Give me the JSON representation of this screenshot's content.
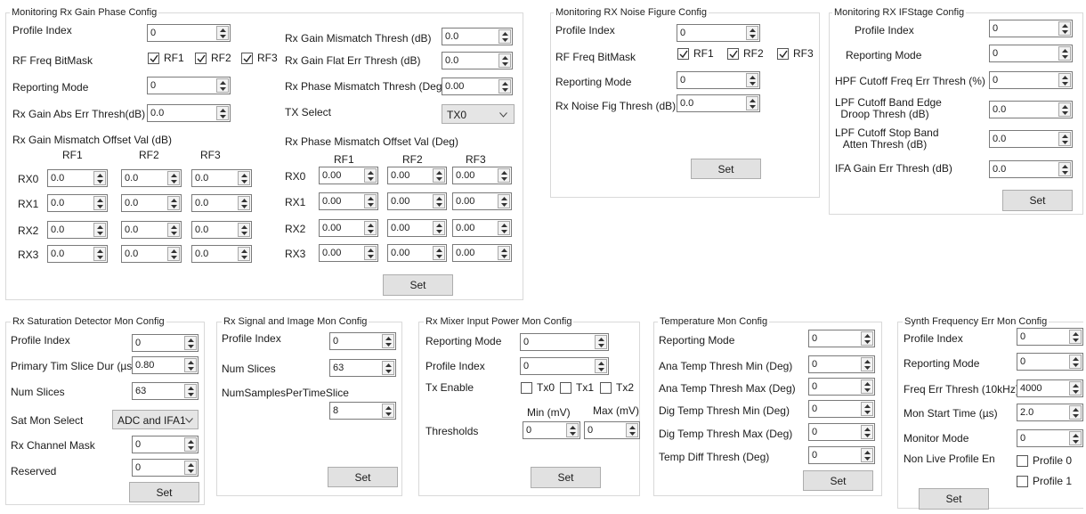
{
  "rx_gain_phase": {
    "title": "Monitoring Rx Gain Phase Config",
    "profile_index_label": "Profile Index",
    "profile_index": "0",
    "rf_freq_label": "RF Freq BitMask",
    "rf1": "RF1",
    "rf2": "RF2",
    "rf3": "RF3",
    "reporting_mode_label": "Reporting Mode",
    "reporting_mode": "0",
    "gain_abs_err_label": "Rx Gain Abs Err Thresh(dB)",
    "gain_abs_err": "0.0",
    "gain_mismatch_thresh_label": "Rx Gain Mismatch Thresh (dB)",
    "gain_mismatch_thresh": "0.0",
    "gain_flat_err_label": "Rx Gain Flat Err Thresh (dB)",
    "gain_flat_err": "0.0",
    "phase_mismatch_thresh_label": "Rx Phase Mismatch Thresh (Deg)",
    "phase_mismatch_thresh": "0.00",
    "tx_select_label": "TX Select",
    "tx_select": "TX0",
    "gain_offset_label": "Rx Gain Mismatch Offset Val (dB)",
    "phase_offset_label": "Rx Phase Mismatch Offset Val (Deg)",
    "cols": [
      "RF1",
      "RF2",
      "RF3"
    ],
    "rows": [
      "RX0",
      "RX1",
      "RX2",
      "RX3"
    ],
    "gain_value": "0.0",
    "phase_value": "0.00",
    "set": "Set"
  },
  "noise_figure": {
    "title": "Monitoring RX Noise Figure Config",
    "profile_index_label": "Profile Index",
    "profile_index": "0",
    "rf_freq_label": "RF Freq BitMask",
    "rf1": "RF1",
    "rf2": "RF2",
    "rf3": "RF3",
    "reporting_mode_label": "Reporting Mode",
    "reporting_mode": "0",
    "noise_fig_thresh_label": "Rx Noise Fig Thresh (dB)",
    "noise_fig_thresh": "0.0",
    "set": "Set"
  },
  "ifstage": {
    "title": "Monitoring RX IFStage Config",
    "profile_index_label": "Profile Index",
    "profile_index": "0",
    "reporting_mode_label": "Reporting Mode",
    "reporting_mode": "0",
    "hpf_label": "HPF Cutoff Freq Err Thresh (%)",
    "hpf": "0",
    "lpf_droop_label1": "LPF Cutoff Band Edge",
    "lpf_droop_label2": "Droop Thresh (dB)",
    "lpf_droop": "0.0",
    "lpf_atten_label1": "LPF Cutoff Stop Band",
    "lpf_atten_label2": "Atten Thresh (dB)",
    "lpf_atten": "0.0",
    "ifa_gain_label": "IFA Gain Err Thresh (dB)",
    "ifa_gain": "0.0",
    "set": "Set"
  },
  "saturation": {
    "title": "Rx Saturation Detector Mon Config",
    "profile_index_label": "Profile Index",
    "profile_index": "0",
    "primary_slice_label": "Primary Tim Slice Dur (µs)",
    "primary_slice": "0.80",
    "num_slices_label": "Num Slices",
    "num_slices": "63",
    "sat_mon_select_label": "Sat Mon Select",
    "sat_mon_select": "ADC and IFA1",
    "channel_mask_label": "Rx Channel Mask",
    "channel_mask": "0",
    "reserved_label": "Reserved",
    "reserved": "0",
    "set": "Set"
  },
  "signal_image": {
    "title": "Rx Signal and Image Mon Config",
    "profile_index_label": "Profile Index",
    "profile_index": "0",
    "num_slices_label": "Num Slices",
    "num_slices": "63",
    "samples_label": "NumSamplesPerTimeSlice",
    "samples": "8",
    "set": "Set"
  },
  "mixer": {
    "title": "Rx Mixer Input Power Mon Config",
    "reporting_mode_label": "Reporting Mode",
    "reporting_mode": "0",
    "profile_index_label": "Profile Index",
    "profile_index": "0",
    "tx_enable_label": "Tx Enable",
    "tx0": "Tx0",
    "tx1": "Tx1",
    "tx2": "Tx2",
    "min_label": "Min (mV)",
    "max_label": "Max (mV)",
    "thresholds_label": "Thresholds",
    "min": "0",
    "max": "0",
    "set": "Set"
  },
  "temperature": {
    "title": "Temperature Mon Config",
    "reporting_mode_label": "Reporting Mode",
    "reporting_mode": "0",
    "ana_min_label": "Ana Temp Thresh Min (Deg)",
    "ana_min": "0",
    "ana_max_label": "Ana Temp Thresh Max (Deg)",
    "ana_max": "0",
    "dig_min_label": "Dig Temp Thresh Min (Deg)",
    "dig_min": "0",
    "dig_max_label": "Dig Temp Thresh Max (Deg)",
    "dig_max": "0",
    "diff_label": "Temp Diff Thresh (Deg)",
    "diff": "0",
    "set": "Set"
  },
  "synth": {
    "title": "Synth Frequency Err Mon Config",
    "profile_index_label": "Profile Index",
    "profile_index": "0",
    "reporting_mode_label": "Reporting Mode",
    "reporting_mode": "0",
    "freq_err_label": "Freq Err Thresh (10kHz)",
    "freq_err": "4000",
    "start_time_label": "Mon Start Time (µs)",
    "start_time": "2.0",
    "monitor_mode_label": "Monitor Mode",
    "monitor_mode": "0",
    "non_live_label": "Non Live Profile En",
    "profile0": "Profile 0",
    "profile1": "Profile 1",
    "set": "Set"
  }
}
